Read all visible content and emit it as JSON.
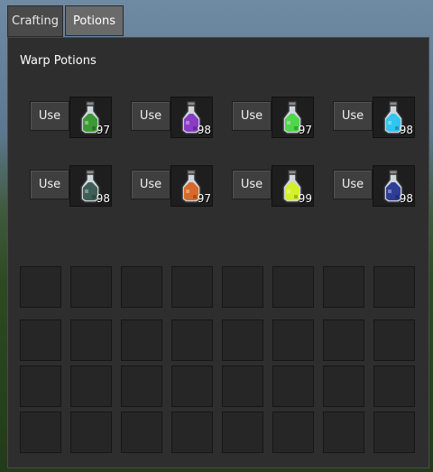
{
  "tabs": [
    {
      "label": "Crafting",
      "active": false
    },
    {
      "label": "Potions",
      "active": true
    }
  ],
  "panel": {
    "title": "Warp Potions"
  },
  "potions": [
    {
      "use_label": "Use",
      "count": "97",
      "color": "#3c9a34",
      "icon": "potion-bottle-icon"
    },
    {
      "use_label": "Use",
      "count": "98",
      "color": "#8a3cc4",
      "icon": "potion-bottle-icon"
    },
    {
      "use_label": "Use",
      "count": "97",
      "color": "#4fd64a",
      "icon": "potion-bottle-icon"
    },
    {
      "use_label": "Use",
      "count": "98",
      "color": "#2fc6f0",
      "icon": "potion-bottle-icon"
    },
    {
      "use_label": "Use",
      "count": "98",
      "color": "#3f5e56",
      "icon": "potion-bottle-icon"
    },
    {
      "use_label": "Use",
      "count": "97",
      "color": "#d66a2a",
      "icon": "potion-bottle-icon"
    },
    {
      "use_label": "Use",
      "count": "99",
      "color": "#d4f02a",
      "icon": "potion-bottle-icon"
    },
    {
      "use_label": "Use",
      "count": "98",
      "color": "#2e3e98",
      "icon": "potion-bottle-icon"
    }
  ],
  "inventory": {
    "hotbar_slots": 8,
    "main_rows": 3,
    "main_cols": 8
  }
}
